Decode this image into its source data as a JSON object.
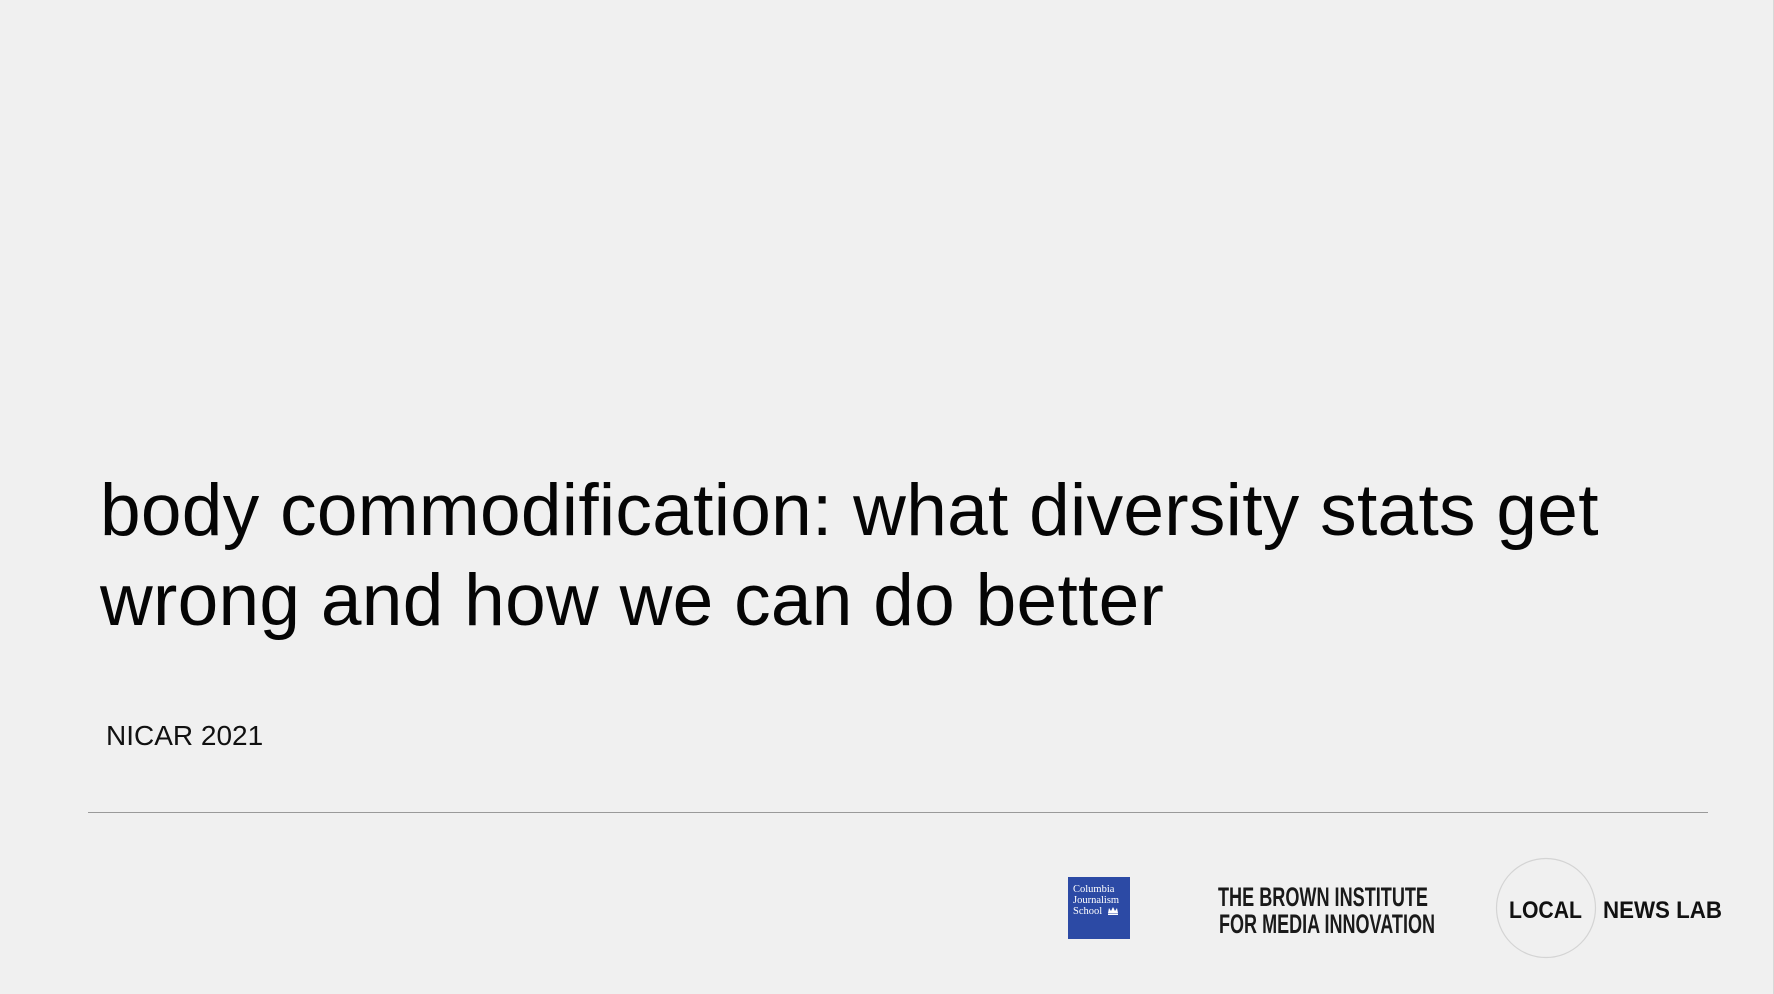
{
  "slide": {
    "title_line1": "body commodification: what diversity stats get",
    "title_line2": "wrong and how we can do better",
    "subtitle": "NICAR 2021"
  },
  "logos": {
    "columbia": {
      "lines": [
        "Columbia",
        "Journalism",
        "School"
      ],
      "color": "#2c4aa5",
      "icon": "columbia-crown-icon"
    },
    "brown": {
      "lines": [
        "THE BROWN INSTITUTE",
        "FOR MEDIA INNOVATION"
      ]
    },
    "local_news_lab": {
      "left": "LOCAL",
      "right": "NEWS LAB"
    }
  },
  "colors": {
    "background": "#f0f0f0",
    "text": "#050505",
    "divider": "#9a9a9a",
    "columbia_blue": "#2c4aa5"
  }
}
